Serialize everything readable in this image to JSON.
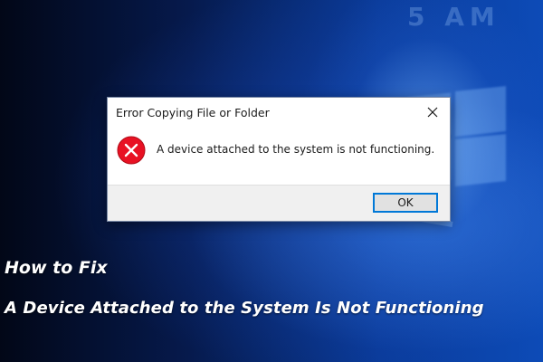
{
  "wallpaper": {
    "background_text": "5 AM"
  },
  "dialog": {
    "title": "Error Copying File or Folder",
    "close_icon": "close-icon",
    "status_icon": "error-icon",
    "message": "A device attached to the system is not functioning.",
    "ok_label": "OK",
    "accent_color": "#0078d7",
    "error_color": "#e81123"
  },
  "caption": {
    "line1": "How to Fix",
    "line2": "A Device Attached to the System Is Not Functioning"
  }
}
